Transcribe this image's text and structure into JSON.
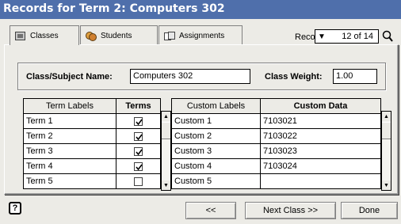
{
  "window": {
    "title": "Records for Term 2: Computers 302"
  },
  "tabs": [
    {
      "label": "Classes",
      "icon": "classes-icon"
    },
    {
      "label": "Students",
      "icon": "students-icon"
    },
    {
      "label": "Assignments",
      "icon": "assignments-icon"
    }
  ],
  "record": {
    "label": "Record:",
    "value": "12 of 14"
  },
  "subject": {
    "name_label": "Class/Subject Name:",
    "name_value": "Computers 302",
    "weight_label": "Class Weight:",
    "weight_value": "1.00"
  },
  "terms_table": {
    "headers": [
      "Term Labels",
      "Terms"
    ],
    "rows": [
      {
        "label": "Term 1",
        "checked": true
      },
      {
        "label": "Term 2",
        "checked": true
      },
      {
        "label": "Term 3",
        "checked": true
      },
      {
        "label": "Term 4",
        "checked": true
      },
      {
        "label": "Term 5",
        "checked": false
      }
    ]
  },
  "custom_table": {
    "headers": [
      "Custom Labels",
      "Custom Data"
    ],
    "rows": [
      {
        "label": "Custom 1",
        "data": "7103021"
      },
      {
        "label": "Custom 2",
        "data": "7103022"
      },
      {
        "label": "Custom 3",
        "data": "7103023"
      },
      {
        "label": "Custom 4",
        "data": "7103024"
      },
      {
        "label": "Custom 5",
        "data": ""
      }
    ]
  },
  "buttons": {
    "prev": "<<",
    "next": "Next Class >>",
    "done": "Done"
  },
  "colors": {
    "titlebar": "#4f6fab",
    "background": "#ecebe6"
  }
}
